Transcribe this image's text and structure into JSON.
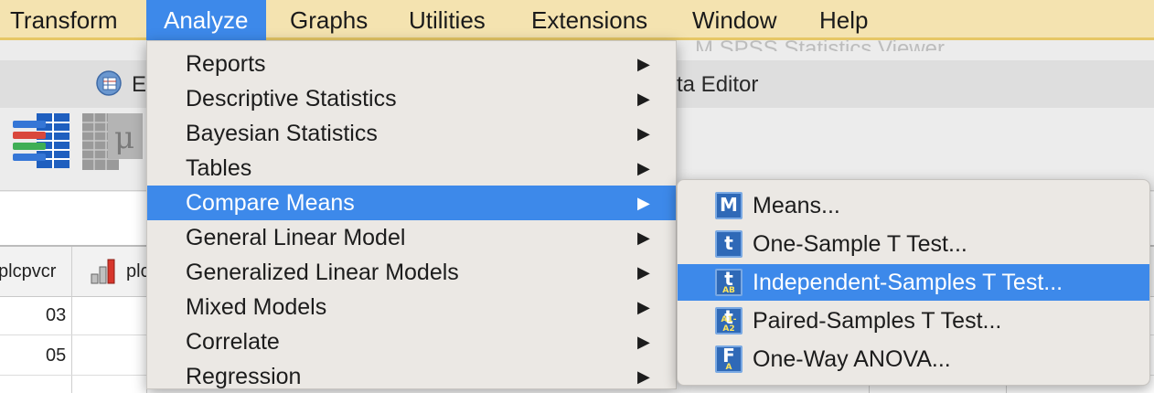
{
  "menubar": {
    "items": [
      {
        "label": "Transform"
      },
      {
        "label": "Analyze"
      },
      {
        "label": "Graphs"
      },
      {
        "label": "Utilities"
      },
      {
        "label": "Extensions"
      },
      {
        "label": "Window"
      },
      {
        "label": "Help"
      }
    ],
    "active_index": 1
  },
  "window": {
    "title_left": "E",
    "title_right": "ta Editor",
    "ghost_title": "M SPSS Statistics Viewer"
  },
  "grid": {
    "col1_header": "plcpvcr",
    "col2_header": "plc",
    "rows": [
      "03",
      "05"
    ]
  },
  "analyze_menu": {
    "items": [
      {
        "label": "Reports",
        "arrow": "▶"
      },
      {
        "label": "Descriptive Statistics",
        "arrow": "▶"
      },
      {
        "label": "Bayesian Statistics",
        "arrow": "▶"
      },
      {
        "label": "Tables",
        "arrow": "▶"
      },
      {
        "label": "Compare Means",
        "arrow": "▶"
      },
      {
        "label": "General Linear Model",
        "arrow": "▶"
      },
      {
        "label": "Generalized Linear Models",
        "arrow": "▶"
      },
      {
        "label": "Mixed Models",
        "arrow": "▶"
      },
      {
        "label": "Correlate",
        "arrow": "▶"
      },
      {
        "label": "Regression",
        "arrow": "▶"
      }
    ],
    "active_index": 4
  },
  "compare_means_submenu": {
    "items": [
      {
        "label": "Means...",
        "icon": "means-icon",
        "glyph": "M",
        "sub": ""
      },
      {
        "label": "One-Sample T Test...",
        "icon": "one-sample-t-icon",
        "glyph": "t",
        "sub": ""
      },
      {
        "label": "Independent-Samples T Test...",
        "icon": "independent-t-icon",
        "glyph": "t",
        "sub": "AB"
      },
      {
        "label": "Paired-Samples T Test...",
        "icon": "paired-t-icon",
        "glyph": "t",
        "sub": "A1-A2"
      },
      {
        "label": "One-Way ANOVA...",
        "icon": "anova-icon",
        "glyph": "F",
        "sub": "A"
      }
    ],
    "active_index": 2
  },
  "colors": {
    "menubar_bg": "#f4e3b0",
    "highlight": "#3d89ea",
    "menu_bg": "#ebe8e4"
  }
}
